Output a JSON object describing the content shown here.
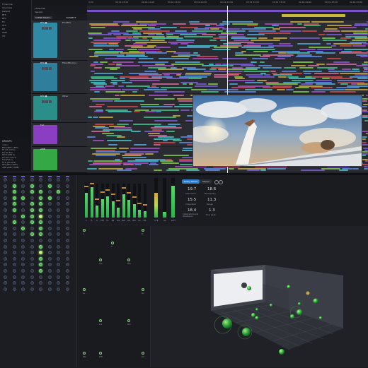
{
  "app": {
    "project_label": "Timecode",
    "project_sub": "Session",
    "header_track": "SCENE MAIN 1",
    "header_link": "CONNECT"
  },
  "ruler": {
    "marks": [
      "0:00",
      "00:01:05:00",
      "00:01:10:00",
      "00:01:15:00",
      "00:01:20:00",
      "00:01:25:00",
      "00:01:30:00",
      "00:01:35:00",
      "00:01:40:00",
      "00:01:45:00",
      "00:01:50:00"
    ]
  },
  "browser": {
    "items": [
      "Timecode",
      "Overview",
      "Default",
      "BFX",
      "BFX",
      "FX",
      "SFX",
      "DX",
      "AMB",
      "VO"
    ]
  },
  "groups": {
    "title": "GROUPS",
    "items": [
      "<ALL>",
      "BFX 1(BFX 1 BFX)",
      "FX (FX 1 FX 1)",
      "DX (FX DX)",
      "SFX S (SFX S)",
      "DX (DX 1 DX 1)",
      "FLX (FLX 1)",
      "FX B (FX DX B)",
      "REV (REV 1 REV)",
      "AMB (AMB 1 AMB)"
    ]
  },
  "tracks": [
    {
      "name": "BFX ●",
      "sub": "FinalMix",
      "color": "#2f8aa5"
    },
    {
      "name": "BFX ●",
      "sub": "MixedBounce",
      "color": "#2f7f9c"
    },
    {
      "name": "BFX ●",
      "sub": "Other",
      "color": "#2a8f88"
    },
    {
      "name": "FLX",
      "sub": "",
      "color": "#8a3fc2"
    },
    {
      "name": "AMB",
      "sub": "",
      "color": "#33a844"
    }
  ],
  "meters": {
    "labels": [
      "L",
      "R",
      "C",
      "LFE",
      "Ls",
      "Rs",
      "Lss",
      "Rss",
      "Lts",
      "Rts",
      "Lb",
      "Rb"
    ],
    "levels": [
      0.72,
      0.9,
      0.35,
      0.55,
      0.62,
      0.48,
      0.3,
      0.68,
      0.52,
      0.4,
      0.22,
      0.18
    ],
    "extra_labels": [
      "LFE",
      "IN",
      "OUT"
    ]
  },
  "loudness": {
    "tab_active": "Dolby Atmos",
    "tab_other": "Stereo",
    "values": [
      {
        "value": "19.7",
        "label": "Short-term"
      },
      {
        "value": "18.6",
        "label": "Momentary"
      },
      {
        "value": "15.5",
        "label": "Integrated"
      },
      {
        "value": "11.3",
        "label": "Range"
      },
      {
        "value": "18.4",
        "label": "Integrated level\n(Dialogue)"
      },
      {
        "value": "1.3",
        "label": "True peak"
      }
    ]
  },
  "pan": {
    "labels": [
      "L",
      "C",
      "R",
      "Ls",
      "Rs",
      "Lss",
      "Rss",
      "Lrs",
      "Rrs",
      "LFE",
      "Lts",
      "Rts"
    ]
  },
  "colors": {
    "accent": "#2f80d5",
    "meter": "#3bc556",
    "track_blue": "#2f8aa5",
    "track_purple": "#8a3fc2",
    "track_green": "#33a844"
  }
}
